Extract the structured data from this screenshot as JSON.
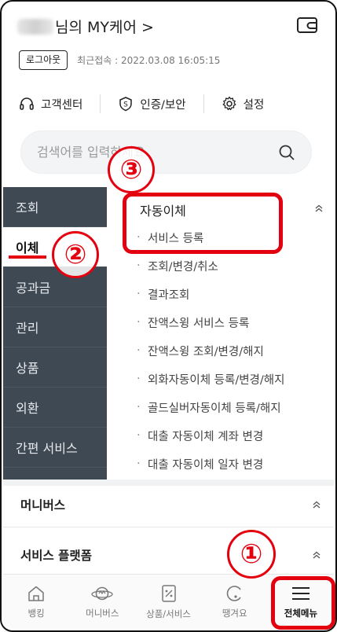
{
  "header": {
    "title_suffix": "님의 MY케어 >"
  },
  "account": {
    "logout_label": "로그아웃",
    "last_login": "최근접속 : 2022.03.08 16:05:15"
  },
  "quick_links": [
    {
      "label": "고객센터",
      "icon": "headset-icon"
    },
    {
      "label": "인증/보안",
      "icon": "shield-icon"
    },
    {
      "label": "설정",
      "icon": "gear-icon"
    }
  ],
  "search": {
    "placeholder": "검색어를 입력하세요."
  },
  "sidebar": {
    "items": [
      "조회",
      "이체",
      "공과금",
      "관리",
      "상품",
      "외환",
      "간편 서비스"
    ],
    "active_index": 1
  },
  "menu": {
    "title": "자동이체",
    "items": [
      "서비스 등록",
      "조회/변경/취소",
      "결과조회",
      "잔액스윙 서비스 등록",
      "잔액스윙 조회/변경/해지",
      "외화자동이체 등록/변경/해지",
      "골드실버자동이체 등록/해지",
      "대출 자동이체 계좌 변경",
      "대출 자동이체 일자 변경"
    ]
  },
  "sections": [
    "머니버스",
    "서비스 플랫폼"
  ],
  "bottom_nav": [
    {
      "label": "뱅킹",
      "icon": "home-icon"
    },
    {
      "label": "머니버스",
      "icon": "planet-icon"
    },
    {
      "label": "상품/서비스",
      "icon": "percent-doc-icon"
    },
    {
      "label": "땡겨요",
      "icon": "delivery-icon"
    },
    {
      "label": "전체메뉴",
      "icon": "hamburger-menu-icon"
    }
  ],
  "annotations": [
    "①",
    "②",
    "③"
  ],
  "colors": {
    "annotation_red": "#e3000f",
    "sidebar_bg": "#3f4954"
  }
}
